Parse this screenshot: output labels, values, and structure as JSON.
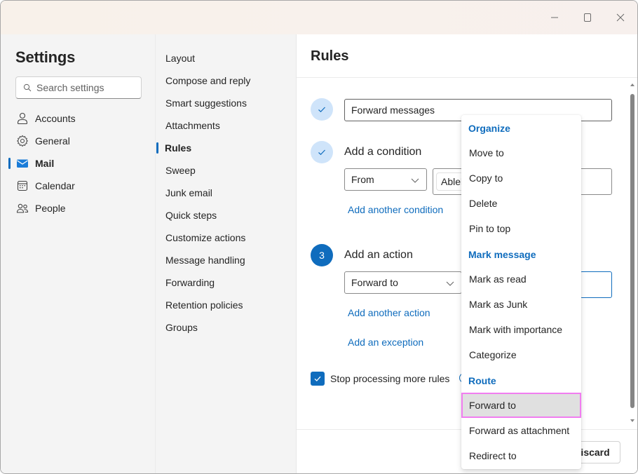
{
  "window": {
    "controls": {
      "minimize": "minimize-icon",
      "maximize": "maximize-icon",
      "close": "close-icon"
    }
  },
  "settings": {
    "title": "Settings",
    "search_placeholder": "Search settings",
    "nav": [
      {
        "label": "Accounts",
        "icon": "person-icon",
        "active": false
      },
      {
        "label": "General",
        "icon": "gear-icon",
        "active": false
      },
      {
        "label": "Mail",
        "icon": "mail-icon",
        "active": true
      },
      {
        "label": "Calendar",
        "icon": "calendar-icon",
        "active": false
      },
      {
        "label": "People",
        "icon": "people-icon",
        "active": false
      }
    ]
  },
  "mail_nav": {
    "items": [
      {
        "label": "Layout",
        "active": false
      },
      {
        "label": "Compose and reply",
        "active": false
      },
      {
        "label": "Smart suggestions",
        "active": false
      },
      {
        "label": "Attachments",
        "active": false
      },
      {
        "label": "Rules",
        "active": true
      },
      {
        "label": "Sweep",
        "active": false
      },
      {
        "label": "Junk email",
        "active": false
      },
      {
        "label": "Quick steps",
        "active": false
      },
      {
        "label": "Customize actions",
        "active": false
      },
      {
        "label": "Message handling",
        "active": false
      },
      {
        "label": "Forwarding",
        "active": false
      },
      {
        "label": "Retention policies",
        "active": false
      },
      {
        "label": "Groups",
        "active": false
      }
    ]
  },
  "rules": {
    "title": "Rules",
    "step1": {
      "state": "complete",
      "name_value": "Forward messages"
    },
    "step2": {
      "state": "complete",
      "label": "Add a condition",
      "condition_select": "From",
      "condition_value_chip": "Ablel",
      "add_link": "Add another condition"
    },
    "step3": {
      "number": "3",
      "label": "Add an action",
      "action_select": "Forward to",
      "add_link": "Add another action",
      "exception_link": "Add an exception"
    },
    "stop_processing": {
      "label": "Stop processing more rules",
      "checked": true
    },
    "discard_label": "Discard"
  },
  "action_menu": {
    "groups": [
      {
        "header": "Organize",
        "items": [
          "Move to",
          "Copy to",
          "Delete",
          "Pin to top"
        ]
      },
      {
        "header": "Mark message",
        "items": [
          "Mark as read",
          "Mark as Junk",
          "Mark with importance",
          "Categorize"
        ]
      },
      {
        "header": "Route",
        "items": [
          "Forward to",
          "Forward as attachment",
          "Redirect to"
        ]
      }
    ],
    "hovered_item": "Forward to"
  },
  "colors": {
    "accent": "#0f6cbd",
    "step_complete_bg": "#cfe4fa",
    "hover_outline": "#f17df0",
    "hover_bg": "#e0e0e0"
  }
}
